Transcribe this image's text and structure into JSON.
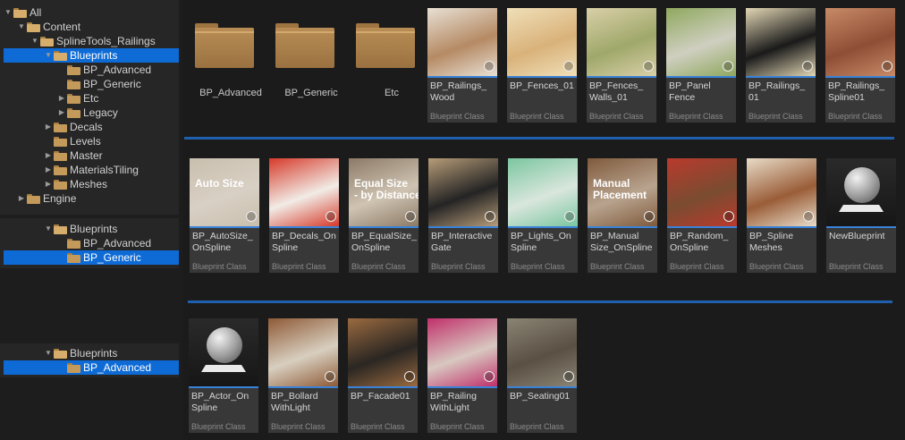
{
  "tree_top": {
    "items": [
      {
        "label": "All",
        "indent": 0,
        "arrow": "▼",
        "open": true,
        "selected": false
      },
      {
        "label": "Content",
        "indent": 1,
        "arrow": "▼",
        "open": true,
        "selected": false
      },
      {
        "label": "SplineTools_Railings",
        "indent": 2,
        "arrow": "▼",
        "open": true,
        "selected": false
      },
      {
        "label": "Blueprints",
        "indent": 3,
        "arrow": "▼",
        "open": true,
        "selected": true
      },
      {
        "label": "BP_Advanced",
        "indent": 4,
        "arrow": "",
        "open": false,
        "selected": false
      },
      {
        "label": "BP_Generic",
        "indent": 4,
        "arrow": "",
        "open": false,
        "selected": false
      },
      {
        "label": "Etc",
        "indent": 4,
        "arrow": "▶",
        "open": false,
        "selected": false
      },
      {
        "label": "Legacy",
        "indent": 4,
        "arrow": "▶",
        "open": false,
        "selected": false
      },
      {
        "label": "Decals",
        "indent": 3,
        "arrow": "▶",
        "open": false,
        "selected": false
      },
      {
        "label": "Levels",
        "indent": 3,
        "arrow": "",
        "open": false,
        "selected": false
      },
      {
        "label": "Master",
        "indent": 3,
        "arrow": "▶",
        "open": false,
        "selected": false
      },
      {
        "label": "MaterialsTiling",
        "indent": 3,
        "arrow": "▶",
        "open": false,
        "selected": false
      },
      {
        "label": "Meshes",
        "indent": 3,
        "arrow": "▶",
        "open": false,
        "selected": false
      },
      {
        "label": "Engine",
        "indent": 1,
        "arrow": "▶",
        "open": false,
        "selected": false
      }
    ]
  },
  "tree_mid": {
    "items": [
      {
        "label": "Blueprints",
        "indent": 3,
        "arrow": "▼",
        "open": true,
        "selected": false
      },
      {
        "label": "BP_Advanced",
        "indent": 4,
        "arrow": "",
        "open": false,
        "selected": false
      },
      {
        "label": "BP_Generic",
        "indent": 4,
        "arrow": "",
        "open": false,
        "selected": true
      }
    ]
  },
  "tree_bot": {
    "items": [
      {
        "label": "Blueprints",
        "indent": 3,
        "arrow": "▼",
        "open": true,
        "selected": false
      },
      {
        "label": "BP_Advanced",
        "indent": 4,
        "arrow": "",
        "open": false,
        "selected": true
      }
    ]
  },
  "folders": [
    "BP_Advanced",
    "BP_Generic",
    "Etc"
  ],
  "class_label": "Blueprint Class",
  "row1": [
    {
      "name": "BP_Railings_\nWood",
      "thumb": "#b58a64",
      "thumb2": "#e8e0d4"
    },
    {
      "name": "BP_Fences_01",
      "thumb": "#d9b27a",
      "thumb2": "#f0dfb8"
    },
    {
      "name": "BP_Fences_\nWalls_01",
      "thumb": "#9fa86a",
      "thumb2": "#d9cfa8"
    },
    {
      "name": "BP_Panel\nFence",
      "thumb": "#cfcfc0",
      "thumb2": "#8fa85e"
    },
    {
      "name": "BP_Railings_\n01",
      "thumb": "#1a1a1a",
      "thumb2": "#e2d6b4"
    },
    {
      "name": "BP_Railings_\nSpline01",
      "thumb": "#8e4e36",
      "thumb2": "#c78a66"
    }
  ],
  "row2": [
    {
      "name": "BP_AutoSize_\nOnSpline",
      "thumb": "#d8d0c4",
      "thumb2": "#c9bfae",
      "caption": "Auto Size"
    },
    {
      "name": "BP_Decals_On\nSpline",
      "thumb": "#f1ece6",
      "thumb2": "#d63a2a",
      "caption": ""
    },
    {
      "name": "BP_EqualSize_\nOnSpline",
      "thumb": "#cfc3b2",
      "thumb2": "#8c7a66",
      "caption": "Equal Size\n- by Distance"
    },
    {
      "name": "BP_Interactive\nGate",
      "thumb": "#242424",
      "thumb2": "#b79c78",
      "caption": ""
    },
    {
      "name": "BP_Lights_On\nSpline",
      "thumb": "#d9e6dc",
      "thumb2": "#7bc6a0",
      "caption": ""
    },
    {
      "name": "BP_Manual\nSize_OnSpline",
      "thumb": "#b8a38e",
      "thumb2": "#7f5a3c",
      "caption": "Manual\nPlacement"
    },
    {
      "name": "BP_Random_\nOnSpline",
      "thumb": "#7a4c30",
      "thumb2": "#b93a2e",
      "caption": ""
    },
    {
      "name": "BP_Spline\nMeshes",
      "thumb": "#9a5d38",
      "thumb2": "#e8dcc8",
      "caption": ""
    },
    {
      "name": "NewBlueprint",
      "thumb": "#1d1d1d",
      "thumb2": "#1d1d1d",
      "caption": "",
      "sphere": true
    }
  ],
  "row3": [
    {
      "name": "BP_Actor_On\nSpline",
      "thumb": "#1d1d1d",
      "thumb2": "#1d1d1d",
      "sphere": true
    },
    {
      "name": "BP_Bollard\nWithLight",
      "thumb": "#d8cfc0",
      "thumb2": "#8e5a36"
    },
    {
      "name": "BP_Facade01",
      "thumb": "#2a2622",
      "thumb2": "#9a6a40"
    },
    {
      "name": "BP_Railing\nWithLight",
      "thumb": "#d8c8c0",
      "thumb2": "#c0306a"
    },
    {
      "name": "BP_Seating01",
      "thumb": "#5a5044",
      "thumb2": "#8a8474"
    }
  ]
}
